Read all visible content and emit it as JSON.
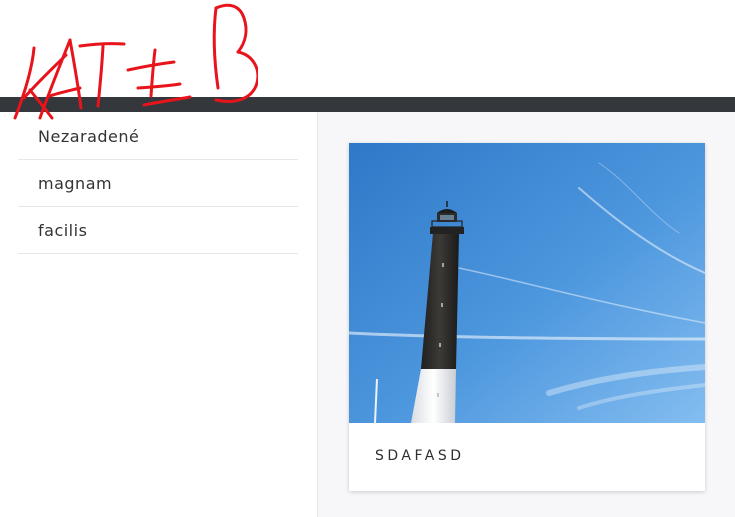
{
  "categories": {
    "items": [
      {
        "label": "Nezaradené"
      },
      {
        "label": "magnam"
      },
      {
        "label": "facilis"
      }
    ]
  },
  "post_card": {
    "title": "SDAFASD"
  },
  "colors": {
    "topbar": "#34383d",
    "logo_stroke": "#e8141c",
    "main_bg": "#f7f7f9",
    "sky": "#4d97de"
  }
}
